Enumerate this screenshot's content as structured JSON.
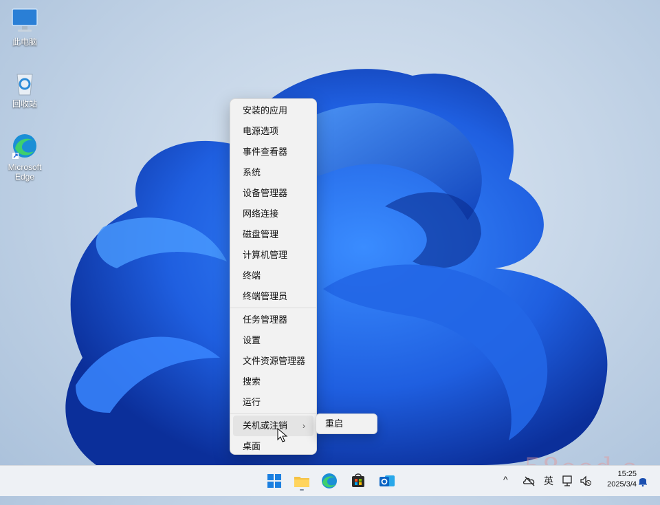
{
  "desktop": {
    "icons": [
      {
        "label": "此电脑",
        "icon": "monitor-icon"
      },
      {
        "label": "回收站",
        "icon": "recycle-bin-icon"
      },
      {
        "label": "Microsoft Edge",
        "icon": "edge-icon"
      }
    ]
  },
  "context_menu": {
    "items": [
      {
        "label": "安装的应用"
      },
      {
        "label": "电源选项"
      },
      {
        "label": "事件查看器"
      },
      {
        "label": "系统"
      },
      {
        "label": "设备管理器"
      },
      {
        "label": "网络连接"
      },
      {
        "label": "磁盘管理"
      },
      {
        "label": "计算机管理"
      },
      {
        "label": "终端"
      },
      {
        "label": "终端管理员"
      },
      {
        "label": "任务管理器"
      },
      {
        "label": "设置"
      },
      {
        "label": "文件资源管理器"
      },
      {
        "label": "搜索"
      },
      {
        "label": "运行"
      },
      {
        "label": "关机或注销",
        "chevron": "›"
      },
      {
        "label": "桌面"
      }
    ],
    "submenu": {
      "items": [
        {
          "label": "重启"
        }
      ]
    }
  },
  "taskbar": {
    "apps": [
      "windows-start-icon",
      "file-explorer-icon",
      "edge-icon",
      "store-icon",
      "outlook-icon"
    ],
    "tray": {
      "chevron": "^",
      "ime": "英",
      "time": "15:25",
      "date": "2025/3/4"
    }
  },
  "watermark": "58ood.s",
  "colors": {
    "accent": "#1a5fd6",
    "menu_bg": "#f2f2f2",
    "taskbar_bg": "#eef1f5"
  }
}
